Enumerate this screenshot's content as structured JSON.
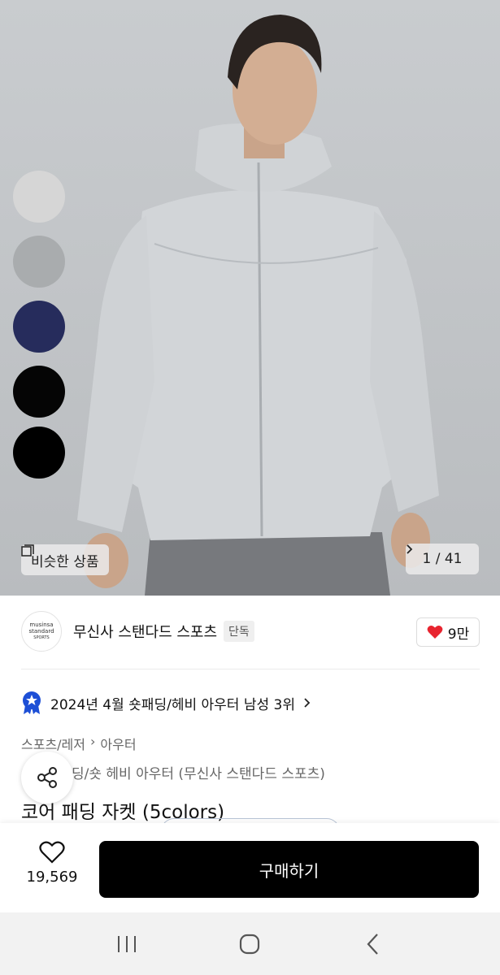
{
  "hero": {
    "swatches": [
      {
        "color": "#d6d6d6"
      },
      {
        "color": "#a9acae"
      },
      {
        "color": "#262c5c"
      },
      {
        "color": "#050505"
      },
      {
        "color": "#000000"
      }
    ],
    "similar_label": "비슷한 상품",
    "counter": "1 / 41"
  },
  "brand": {
    "logo_line1": "musinsa",
    "logo_line2": "standard",
    "logo_line3": "SPORTS",
    "name": "무신사 스탠다드 스포츠",
    "badge": "단독",
    "likes": "9만"
  },
  "ranking": {
    "text": "2024년 4월 숏패딩/헤비 아우터 남성 3위"
  },
  "breadcrumb": {
    "level1": "스포츠/레저",
    "level2": "아우터"
  },
  "product": {
    "subline": "딩/숏 헤비 아우터 (무신사 스탠다드 스포츠)",
    "title": "코어 패딩 자켓 (5colors)"
  },
  "purchase": {
    "wish_count": "19,569",
    "buy_label": "구매하기"
  },
  "colors": {
    "accent": "#000000",
    "heart": "#e8242f",
    "rank_badge": "#1d4fd6"
  }
}
